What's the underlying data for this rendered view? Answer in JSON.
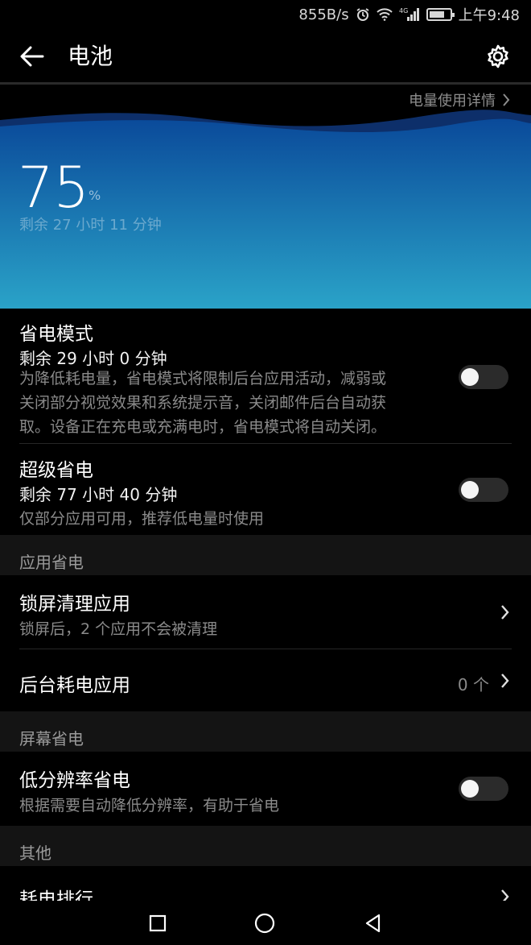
{
  "status_bar": {
    "speed": "855B/s",
    "time": "上午9:48",
    "network": "4G",
    "battery_level": 0.75
  },
  "app_bar": {
    "title": "电池",
    "back_icon": "back-arrow-icon",
    "settings_icon": "gear-icon"
  },
  "hero": {
    "usage_link": "电量使用详情",
    "percent": "75",
    "percent_unit": "%",
    "remaining": "剩余 27 小时 11 分钟",
    "colors": {
      "top": "#0a4a9a",
      "bottom": "#2aa3c8"
    }
  },
  "power_saving": {
    "title": "省电模式",
    "remaining": "剩余 29 小时 0 分钟",
    "desc_lines": [
      "为降低耗电量，省电模式将限制后台应用活动，减弱或",
      "关闭部分视觉效果和系统提示音，关闭邮件后台自动获",
      "取。设备正在充电或充满电时，省电模式将自动关闭。"
    ],
    "enabled": false
  },
  "ultra_saving": {
    "title": "超级省电",
    "remaining": "剩余 77 小时 40 分钟",
    "desc": "仅部分应用可用，推荐低电量时使用",
    "enabled": false
  },
  "section_app": {
    "label": "应用省电"
  },
  "lock_clean": {
    "title": "锁屏清理应用",
    "desc": "锁屏后，2 个应用不会被清理"
  },
  "background_apps": {
    "title": "后台耗电应用",
    "value": "0 个"
  },
  "section_screen": {
    "label": "屏幕省电"
  },
  "low_res": {
    "title": "低分辨率省电",
    "desc": "根据需要自动降低分辨率，有助于省电",
    "enabled": false
  },
  "section_other": {
    "label": "其他"
  },
  "ranking": {
    "title": "耗电排行"
  },
  "nav": {
    "recent_icon": "square-icon",
    "home_icon": "circle-icon",
    "back_icon": "triangle-back-icon"
  }
}
